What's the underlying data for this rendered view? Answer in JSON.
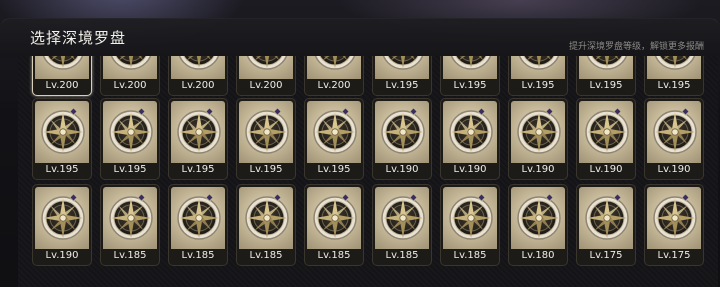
{
  "header": {
    "title": "选择深境罗盘",
    "hint": "提升深境罗盘等级，解锁更多报酬"
  },
  "rows": [
    {
      "levels": [
        "Lv.200",
        "Lv.200",
        "Lv.200",
        "Lv.200",
        "Lv.200",
        "Lv.195",
        "Lv.195",
        "Lv.195",
        "Lv.195",
        "Lv.195"
      ]
    },
    {
      "levels": [
        "Lv.195",
        "Lv.195",
        "Lv.195",
        "Lv.195",
        "Lv.195",
        "Lv.190",
        "Lv.190",
        "Lv.190",
        "Lv.190",
        "Lv.190"
      ]
    },
    {
      "levels": [
        "Lv.190",
        "Lv.185",
        "Lv.185",
        "Lv.185",
        "Lv.185",
        "Lv.185",
        "Lv.185",
        "Lv.180",
        "Lv.175",
        "Lv.175"
      ]
    }
  ],
  "selected": {
    "row": 0,
    "index": 0
  },
  "colors": {
    "accent": "#d9cfb8",
    "text": "#f0ede6",
    "panel": "#141417"
  },
  "icon": "compass-icon"
}
